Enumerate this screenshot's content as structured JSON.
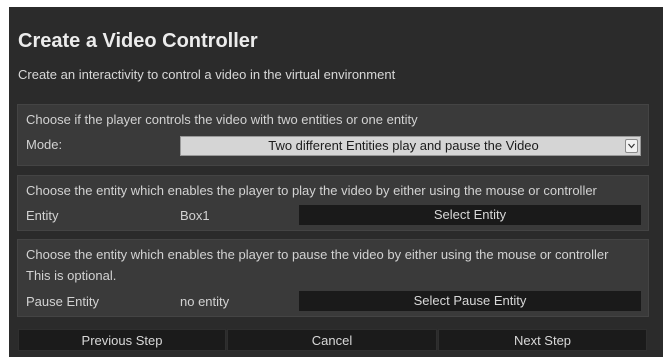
{
  "dialog": {
    "title": "Create a Video Controller",
    "subtitle": "Create an interactivity to control a video in the virtual environment"
  },
  "mode_section": {
    "description": "Choose if the player controls the video with two entities or one entity",
    "label": "Mode:",
    "selected_option": "Two different Entities play and pause the Video"
  },
  "play_section": {
    "description": "Choose the entity which enables the player to play the video by either using the mouse or controller",
    "label": "Entity",
    "value": "Box1",
    "button_label": "Select Entity"
  },
  "pause_section": {
    "description": "Choose the entity which enables the player to pause the video by either using the mouse or controller",
    "note": "This is optional.",
    "label": "Pause Entity",
    "value": "no entity",
    "button_label": "Select Pause Entity"
  },
  "footer": {
    "previous_label": "Previous Step",
    "cancel_label": "Cancel",
    "next_label": "Next Step"
  },
  "colors": {
    "dialog_bg": "#2b2b2b",
    "section_bg": "#3a3a3a",
    "button_bg": "#1a1a1a",
    "text": "#d2d2d2"
  }
}
